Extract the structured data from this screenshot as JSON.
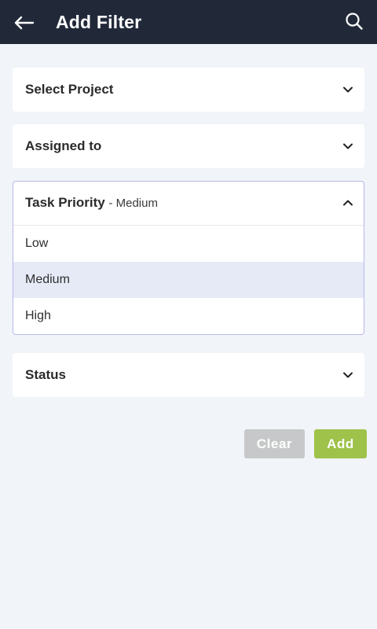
{
  "header": {
    "title": "Add Filter",
    "back_icon": "arrow-left-icon",
    "search_icon": "search-icon",
    "background": "#212939"
  },
  "filters": {
    "project": {
      "label": "Select Project"
    },
    "assigned": {
      "label": "Assigned to"
    },
    "priority": {
      "label": "Task Priority",
      "value": "- Medium",
      "expanded": true,
      "options": [
        "Low",
        "Medium",
        "High"
      ],
      "selected": "Medium"
    },
    "status": {
      "label": "Status"
    }
  },
  "actions": {
    "clear_label": "Clear",
    "add_label": "Add",
    "clear_color": "#c7c8c9",
    "add_color": "#9ec24a"
  }
}
